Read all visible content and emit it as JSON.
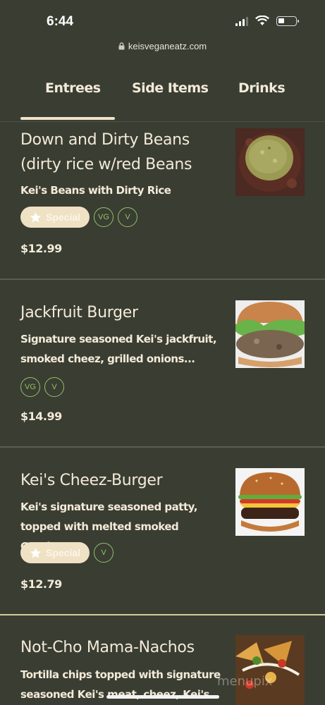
{
  "status": {
    "time": "6:44"
  },
  "browser": {
    "url": "keisveganeatz.com"
  },
  "tabs": [
    {
      "label": "Entrees",
      "active": true
    },
    {
      "label": "Side Items",
      "active": false
    },
    {
      "label": "Drinks",
      "active": false
    }
  ],
  "items": [
    {
      "title_line1": "Down and Dirty Beans",
      "title_line2": "(dirty rice w/red Beans",
      "desc_line1": "Kei's Beans with Dirty Rice",
      "desc_line2": "",
      "special": "Special",
      "badges": [
        "VG",
        "V"
      ],
      "price": "$12.99",
      "image": "beans-and-rice"
    },
    {
      "title_line1": "Jackfruit Burger",
      "title_line2": "",
      "desc_line1": "Signature seasoned Kei's jackfruit,",
      "desc_line2": "smoked cheez, grilled onions...",
      "special": "",
      "badges": [
        "VG",
        "V"
      ],
      "price": "$14.99",
      "image": "jackfruit-burger"
    },
    {
      "title_line1": "Kei's Cheez-Burger",
      "title_line2": "",
      "desc_line1": "Kei's signature seasoned patty,",
      "desc_line2": "topped with melted smoked Gouda...",
      "special": "Special",
      "badges": [
        "V"
      ],
      "price": "$12.79",
      "image": "cheeze-burger"
    },
    {
      "title_line1": "Not-Cho Mama-Nachos",
      "title_line2": "",
      "desc_line1": "Tortilla chips topped with signature",
      "desc_line2": "seasoned Kei's meat, cheez, Kei's",
      "image": "nachos"
    }
  ],
  "watermark": "menupix",
  "colors": {
    "background": "#3a3d32",
    "cream": "#efe1c4",
    "vegan_green": "#8fc169"
  }
}
